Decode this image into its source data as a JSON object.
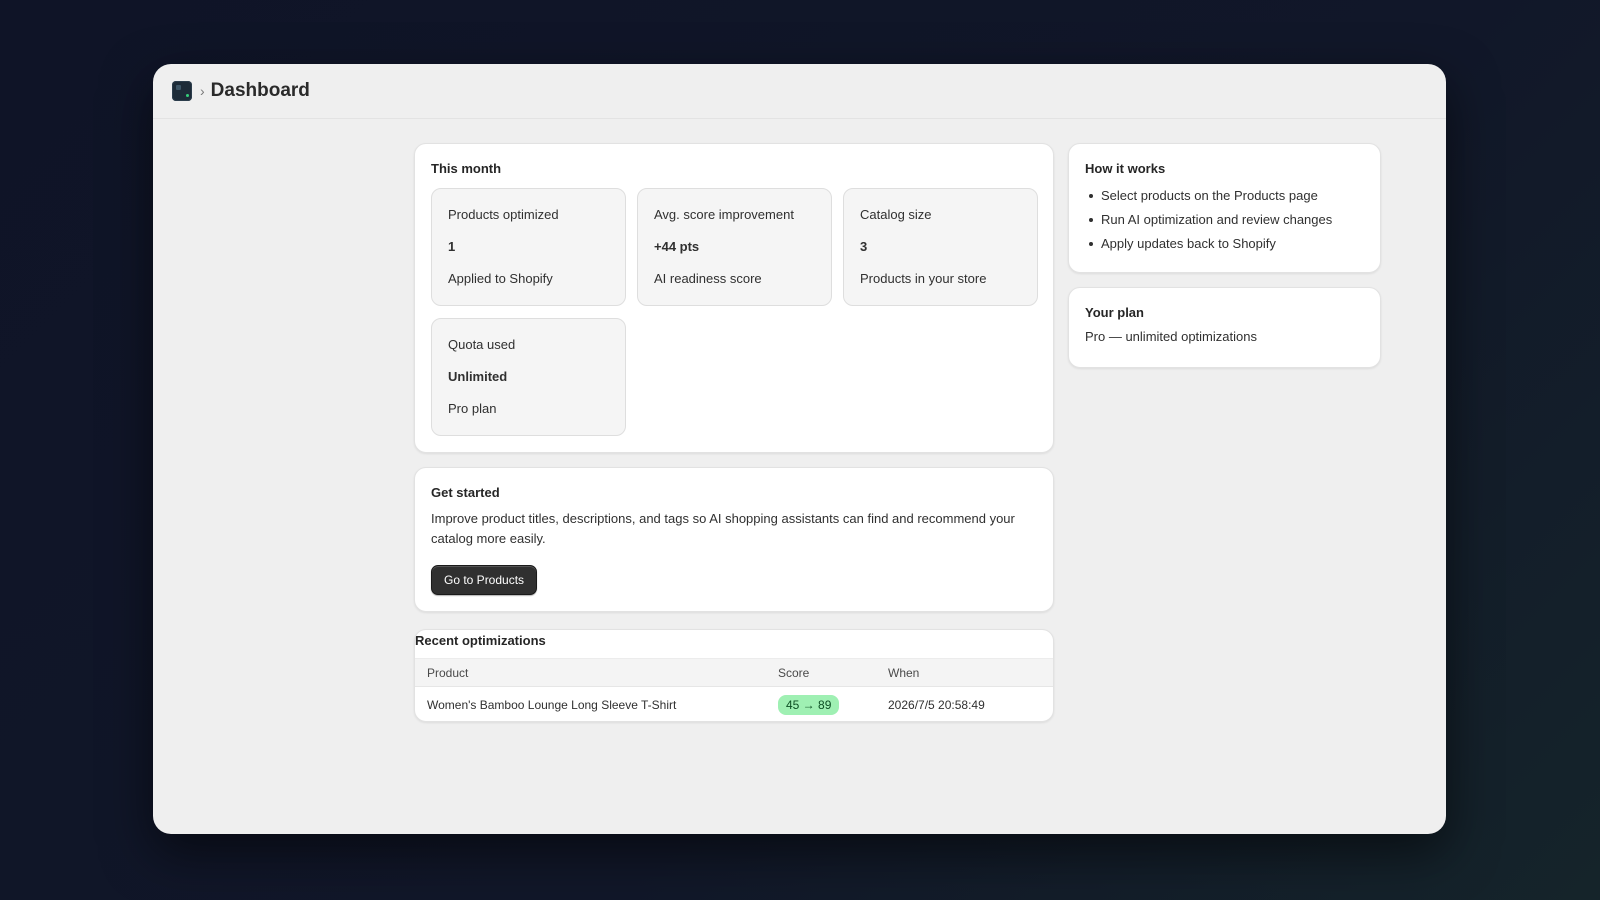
{
  "header": {
    "title": "Dashboard",
    "separator": "›"
  },
  "this_month": {
    "title": "This month",
    "stats": [
      {
        "label": "Products optimized",
        "value": "1",
        "caption": "Applied to Shopify"
      },
      {
        "label": "Avg. score improvement",
        "value": "+44 pts",
        "caption": "AI readiness score"
      },
      {
        "label": "Catalog size",
        "value": "3",
        "caption": "Products in your store"
      },
      {
        "label": "Quota used",
        "value": "Unlimited",
        "caption": "Pro plan"
      }
    ]
  },
  "get_started": {
    "title": "Get started",
    "text": "Improve product titles, descriptions, and tags so AI shopping assistants can find and recommend your catalog more easily.",
    "button_label": "Go to Products"
  },
  "recent": {
    "title": "Recent optimizations",
    "columns": [
      "Product",
      "Score",
      "When"
    ],
    "rows": [
      {
        "product": "Women's Bamboo Lounge Long Sleeve T-Shirt",
        "score": "45 → 89",
        "when": "2026/7/5 20:58:49"
      }
    ]
  },
  "how_it_works": {
    "title": "How it works",
    "steps": [
      "Select products on the Products page",
      "Run AI optimization and review changes",
      "Apply updates back to Shopify"
    ]
  },
  "plan": {
    "title": "Your plan",
    "text": "Pro — unlimited optimizations"
  },
  "colors": {
    "accent": "#303030",
    "badge_bg": "#9ff0b3",
    "badge_text": "#0c4f23"
  }
}
